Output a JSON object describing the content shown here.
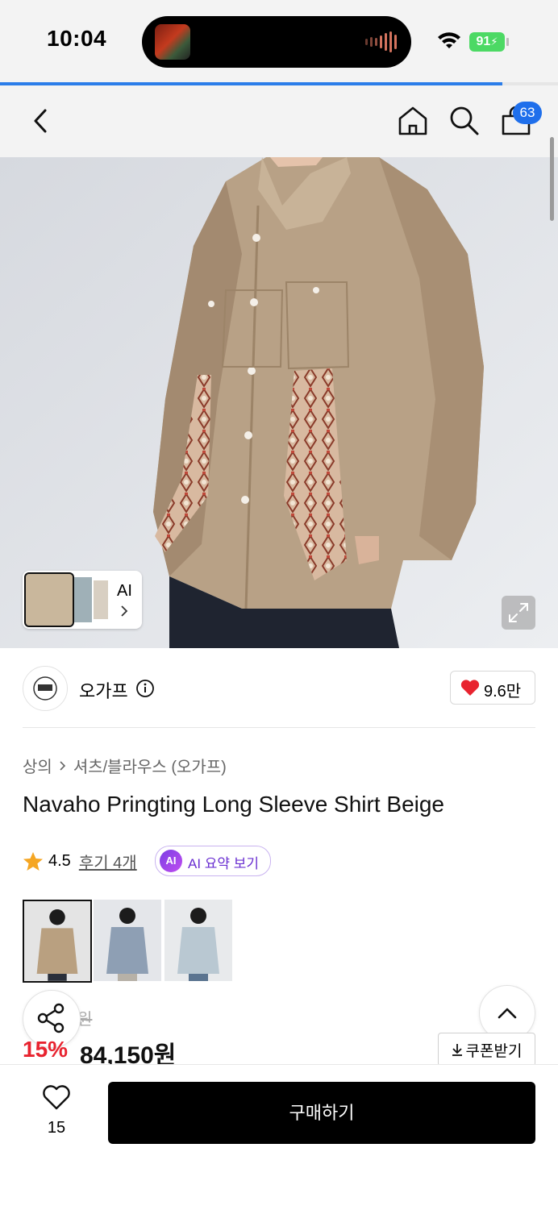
{
  "status_bar": {
    "time": "10:04",
    "battery": "91"
  },
  "page_progress": 0.9,
  "nav": {
    "cart_count": "63",
    "icons": [
      "back-icon",
      "home-icon",
      "search-icon",
      "cart-icon"
    ]
  },
  "hero": {
    "ai_label": "AI"
  },
  "brand": {
    "name": "오가프",
    "likes": "9.6만"
  },
  "breadcrumb": {
    "category": "상의",
    "subcategory": "셔츠/블라우스 (오가프)"
  },
  "product": {
    "title": "Navaho Pringting Long Sleeve Shirt Beige",
    "rating": "4.5",
    "reviews": "후기 4개",
    "ai_summary": "AI 요약 보기",
    "ai_badge": "AI",
    "original_price_visible": "원",
    "discount": "15%",
    "price": "84,150원",
    "coupon": "쿠폰받기"
  },
  "bottom": {
    "wish_count": "15",
    "buy_label": "구매하기"
  },
  "colors": {
    "accent_blue": "#1f6feb",
    "discount_red": "#e8232f",
    "ai_purple": "#6a2fd1",
    "battery_green": "#4cd964"
  }
}
